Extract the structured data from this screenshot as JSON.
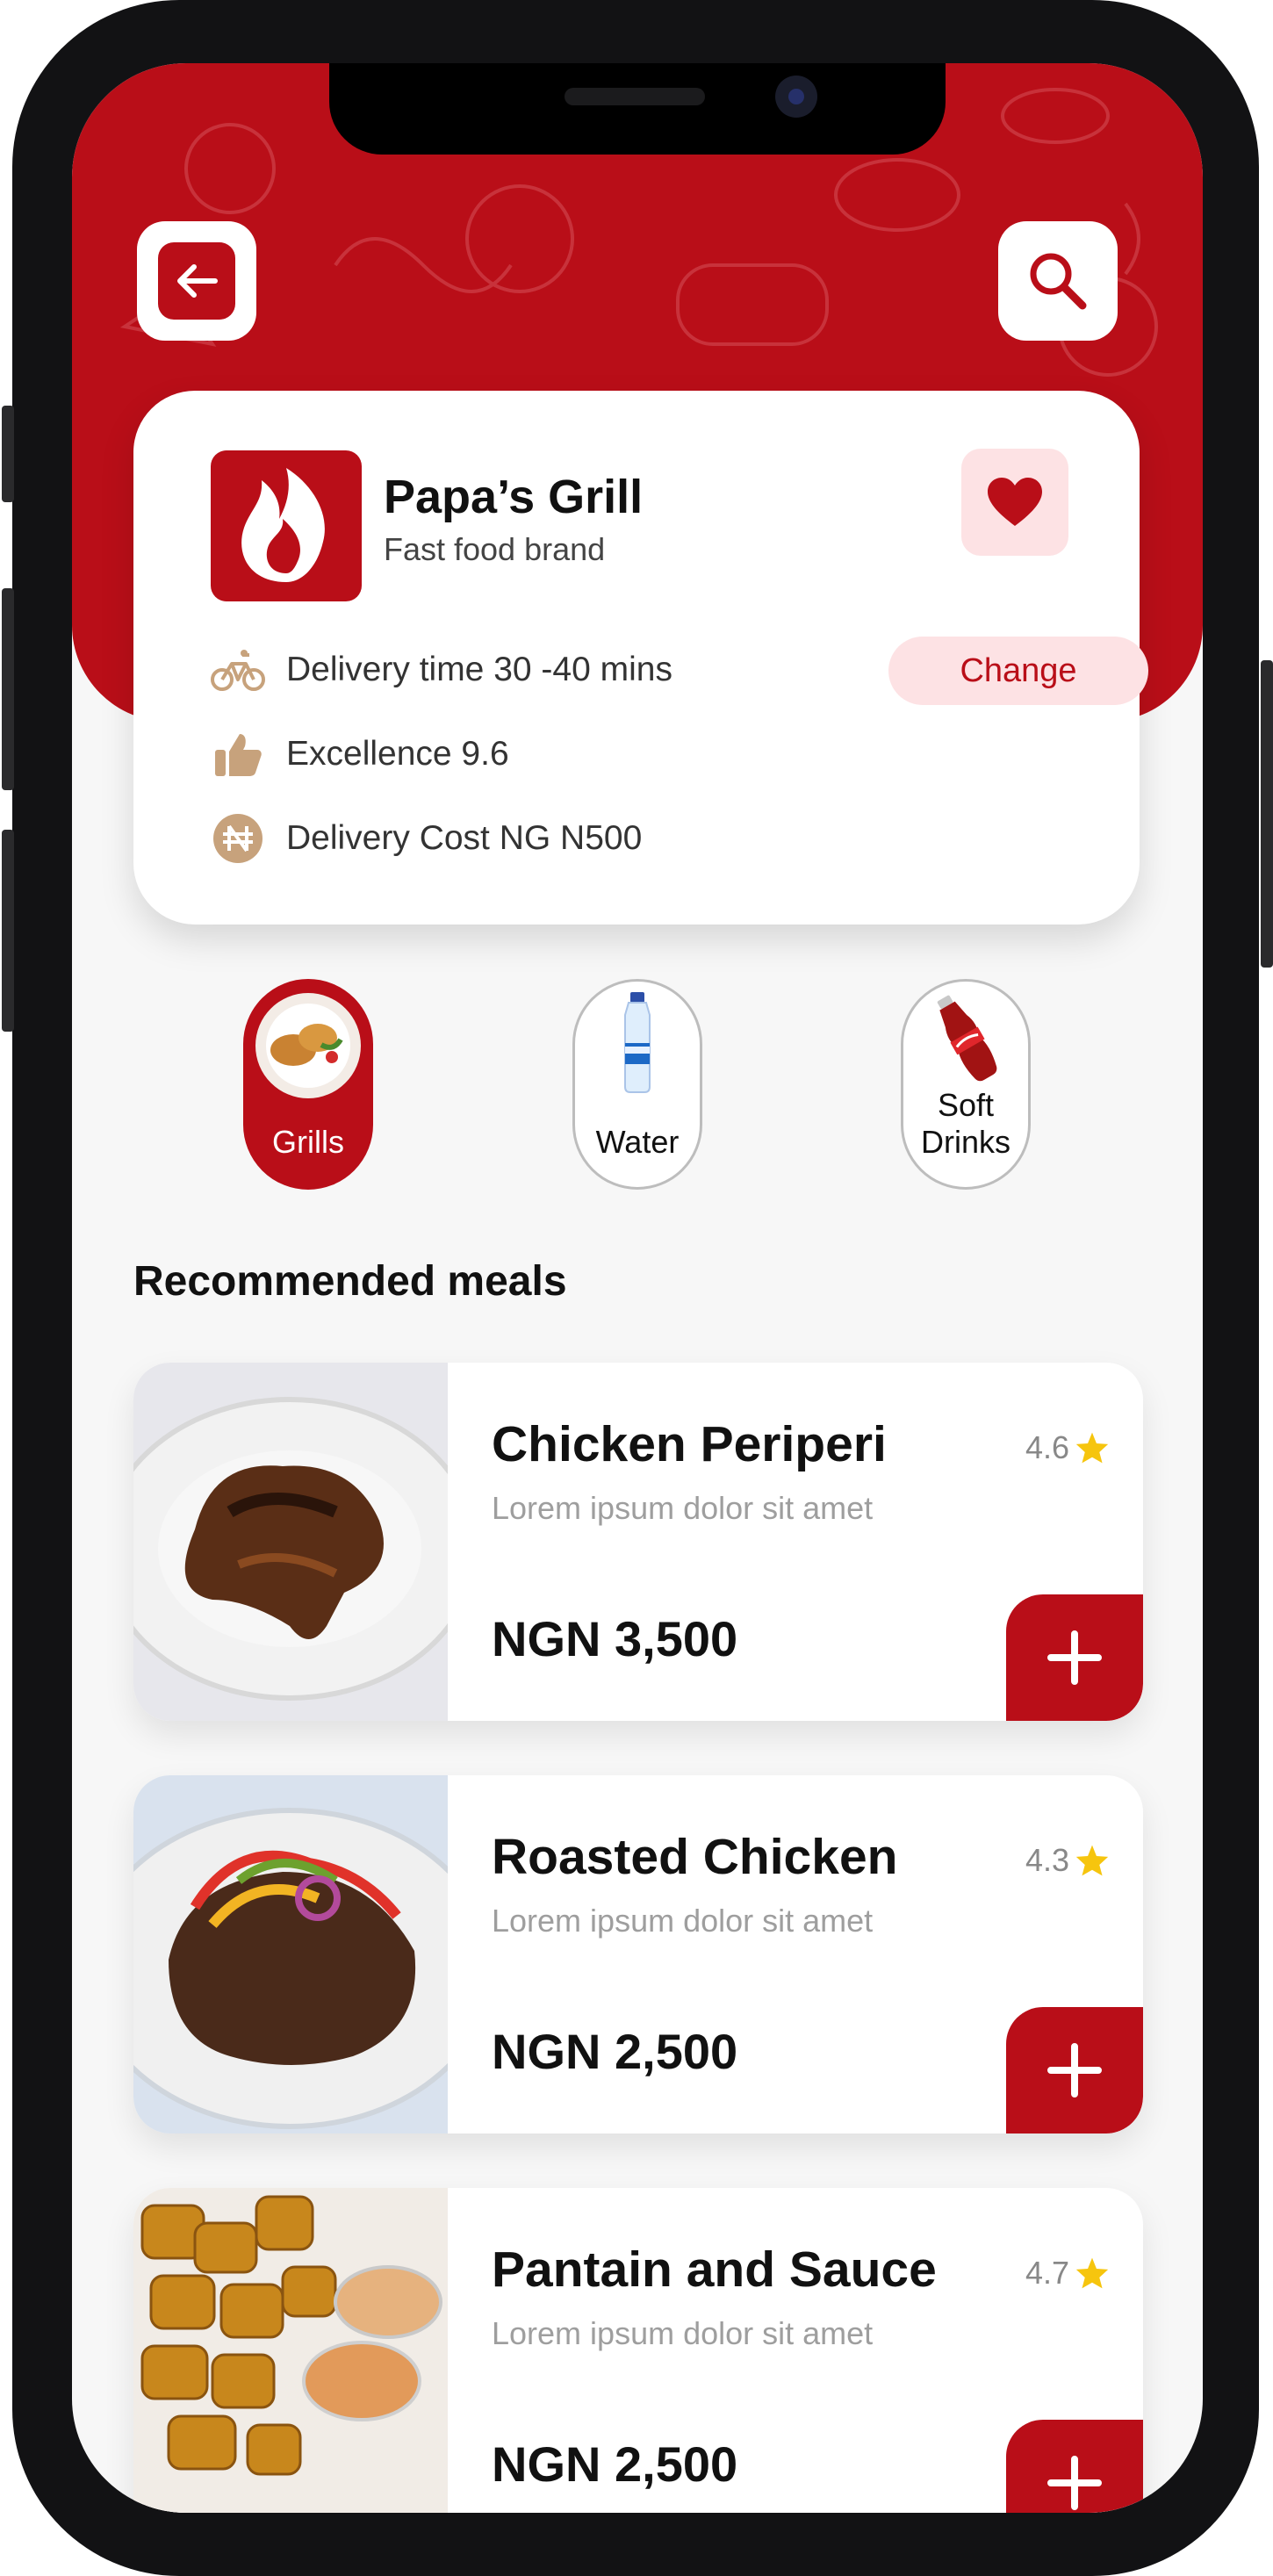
{
  "colors": {
    "accent": "#b90e18",
    "accent_light": "#fde2e4",
    "star": "#f6c50e",
    "icon_tan": "#c7a27c"
  },
  "header": {
    "back_icon": "arrow-left-icon",
    "search_icon": "search-icon"
  },
  "restaurant": {
    "name": "Papa’s Grill",
    "type": "Fast food brand",
    "delivery_time": "Delivery time 30 -40 mins",
    "excellence": "Excellence 9.6",
    "delivery_cost": "Delivery Cost NG N500",
    "change_label": "Change"
  },
  "categories": [
    {
      "label": "Grills",
      "active": true
    },
    {
      "label": "Water",
      "active": false
    },
    {
      "label": "Soft Drinks",
      "active": false
    }
  ],
  "recommended_title": "Recommended meals",
  "meals": [
    {
      "name": "Chicken Periperi",
      "desc": "Lorem ipsum dolor sit amet",
      "price": "NGN 3,500",
      "rating": "4.6"
    },
    {
      "name": "Roasted Chicken",
      "desc": "Lorem ipsum dolor sit amet",
      "price": "NGN 2,500",
      "rating": "4.3"
    },
    {
      "name": "Pantain and Sauce",
      "desc": "Lorem ipsum dolor sit amet",
      "price": "NGN 2,500",
      "rating": "4.7"
    }
  ]
}
